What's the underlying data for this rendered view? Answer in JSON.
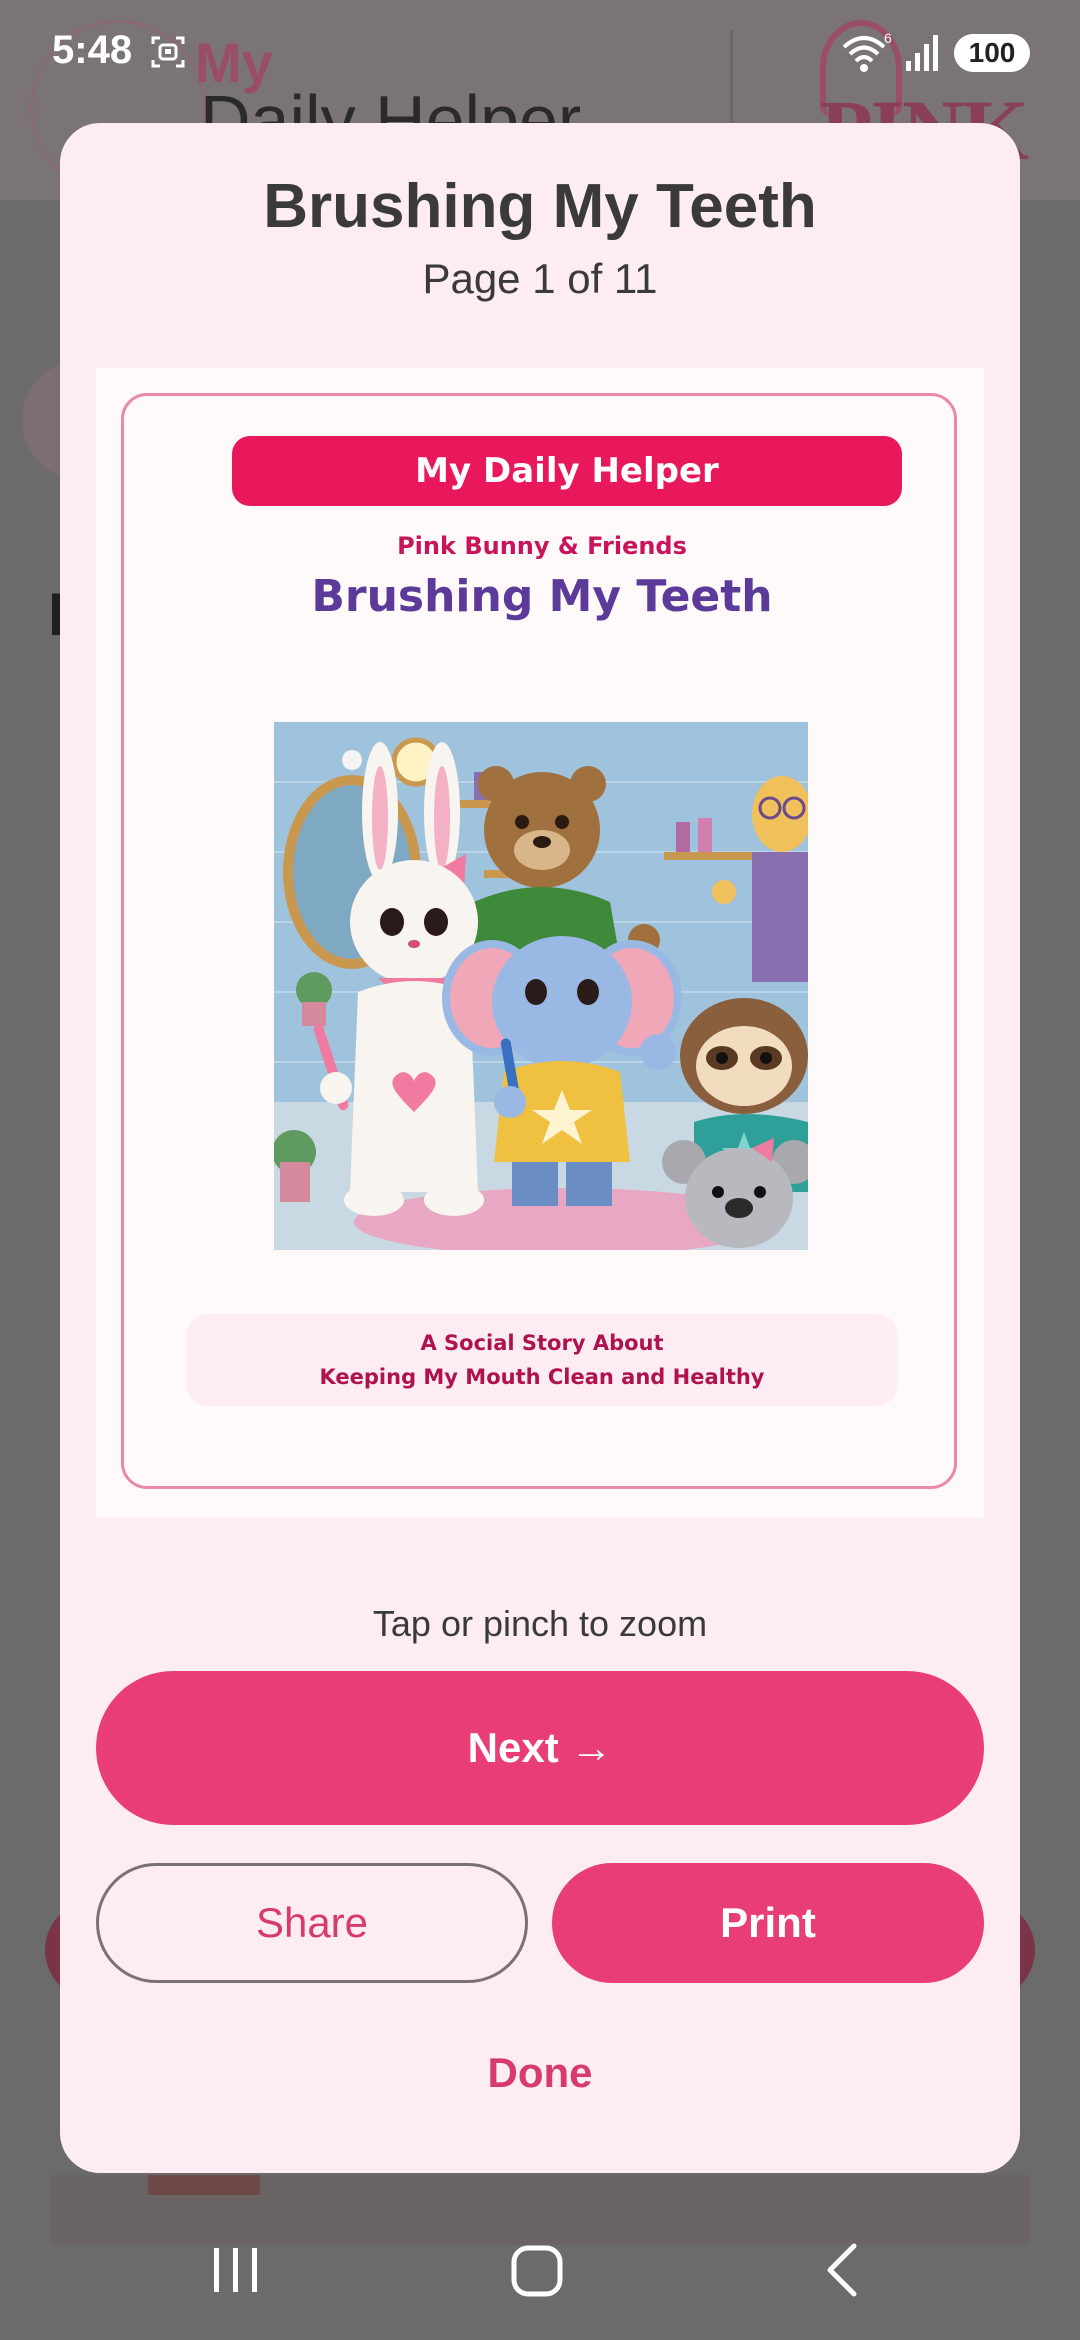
{
  "status_bar": {
    "time": "5:48",
    "wifi_superscript": "6",
    "battery": "100"
  },
  "background_app": {
    "logo_my": "My",
    "logo_text": "Daily Helper",
    "brand_text": "PINK"
  },
  "modal": {
    "title": "Brushing My Teeth",
    "page_indicator": "Page 1 of 11",
    "preview": {
      "banner": "My Daily Helper",
      "kicker": "Pink Bunny & Friends",
      "title": "Brushing My Teeth",
      "caption_line1": "A Social Story About",
      "caption_line2": "Keeping My Mouth Clean and Healthy"
    },
    "zoom_hint": "Tap or pinch to zoom",
    "next_label": "Next →",
    "share_label": "Share",
    "print_label": "Print",
    "done_label": "Done"
  },
  "colors": {
    "accent": "#e83d75",
    "banner": "#e8185b",
    "preview_title": "#5b3a9a",
    "modal_background": "#fdedf2"
  },
  "icons": {
    "nav_recents": "recents-icon",
    "nav_home": "home-icon",
    "nav_back": "back-icon"
  }
}
